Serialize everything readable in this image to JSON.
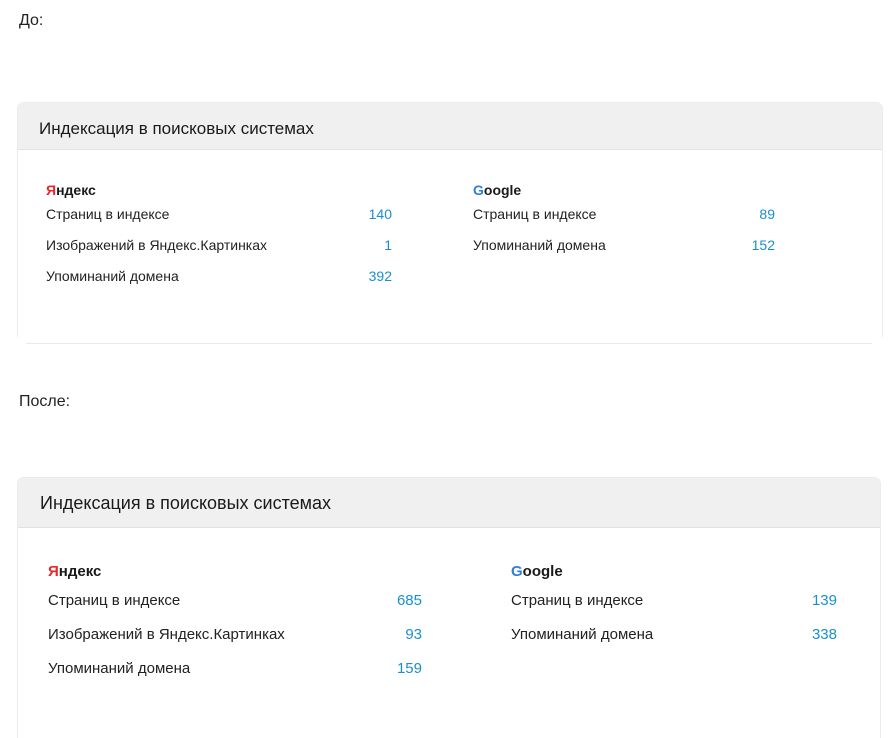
{
  "before": {
    "label": "До:",
    "card": {
      "title": "Индексация в поисковых системах",
      "yandex": {
        "name_first": "Я",
        "name_rest": "ндекс",
        "rows": [
          {
            "label": "Страниц в индексе",
            "value": "140"
          },
          {
            "label": "Изображений в Яндекс.Картинках",
            "value": "1"
          },
          {
            "label": "Упоминаний домена",
            "value": "392"
          }
        ]
      },
      "google": {
        "name_first": "G",
        "name_rest": "oogle",
        "rows": [
          {
            "label": "Страниц в индексе",
            "value": "89"
          },
          {
            "label": "Упоминаний домена",
            "value": "152"
          }
        ]
      }
    }
  },
  "after": {
    "label": "После:",
    "card": {
      "title": "Индексация в поисковых системах",
      "yandex": {
        "name_first": "Я",
        "name_rest": "ндекс",
        "rows": [
          {
            "label": "Страниц в индексе",
            "value": "685"
          },
          {
            "label": "Изображений в Яндекс.Картинках",
            "value": "93"
          },
          {
            "label": "Упоминаний домена",
            "value": "159"
          }
        ]
      },
      "google": {
        "name_first": "G",
        "name_rest": "oogle",
        "rows": [
          {
            "label": "Страниц в индексе",
            "value": "139"
          },
          {
            "label": "Упоминаний домена",
            "value": "338"
          }
        ]
      }
    }
  },
  "colors": {
    "yandex_accent": "#e8272b",
    "google_accent": "#2f7fd9",
    "value_link": "#1a8fce",
    "header_bg": "#f0f0f0"
  }
}
